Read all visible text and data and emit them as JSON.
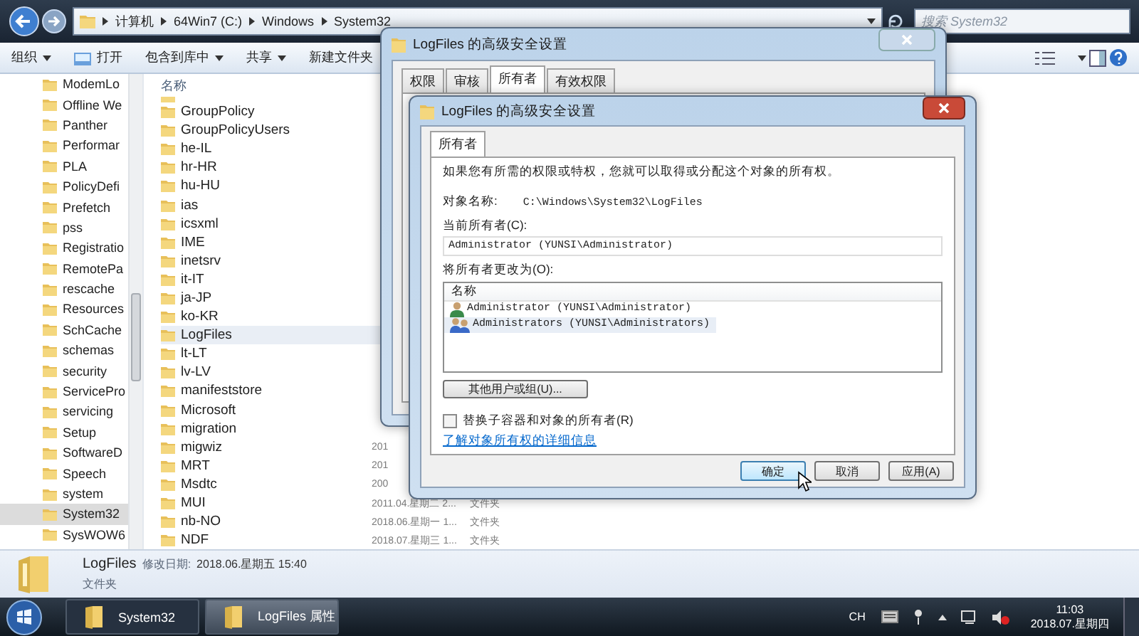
{
  "explorer": {
    "address": [
      "计算机",
      "64Win7 (C:)",
      "Windows",
      "System32"
    ],
    "search": {
      "placeholder": "搜索 System32"
    },
    "toolbar": [
      {
        "kind": "plain",
        "label": "组织",
        "dropdown": true
      },
      {
        "kind": "icon",
        "label": "打开",
        "dropdown": false
      },
      {
        "kind": "plain",
        "label": "包含到库中",
        "dropdown": true
      },
      {
        "kind": "plain",
        "label": "共享",
        "dropdown": true
      },
      {
        "kind": "plain",
        "label": "新建文件夹",
        "dropdown": false
      }
    ],
    "nav": [
      {
        "label": "ModemLo",
        "selected": false
      },
      {
        "label": "Offline We",
        "selected": false
      },
      {
        "label": "Panther",
        "selected": false
      },
      {
        "label": "Performar",
        "selected": false
      },
      {
        "label": "PLA",
        "selected": false
      },
      {
        "label": "PolicyDefi",
        "selected": false
      },
      {
        "label": "Prefetch",
        "selected": false
      },
      {
        "label": "pss",
        "selected": false
      },
      {
        "label": "Registratio",
        "selected": false
      },
      {
        "label": "RemotePa",
        "selected": false
      },
      {
        "label": "rescache",
        "selected": false
      },
      {
        "label": "Resources",
        "selected": false
      },
      {
        "label": "SchCache",
        "selected": false
      },
      {
        "label": "schemas",
        "selected": false
      },
      {
        "label": "security",
        "selected": false
      },
      {
        "label": "ServicePro",
        "selected": false
      },
      {
        "label": "servicing",
        "selected": false
      },
      {
        "label": "Setup",
        "selected": false
      },
      {
        "label": "SoftwareD",
        "selected": false
      },
      {
        "label": "Speech",
        "selected": false
      },
      {
        "label": "system",
        "selected": false
      },
      {
        "label": "System32",
        "selected": true
      },
      {
        "label": "SysWOW6",
        "selected": false
      }
    ],
    "files": {
      "column": "名称",
      "rows": [
        {
          "name": "GroupPolicy",
          "selected": false
        },
        {
          "name": "GroupPolicyUsers",
          "selected": false
        },
        {
          "name": "he-IL",
          "selected": false
        },
        {
          "name": "hr-HR",
          "selected": false
        },
        {
          "name": "hu-HU",
          "selected": false
        },
        {
          "name": "ias",
          "selected": false
        },
        {
          "name": "icsxml",
          "selected": false
        },
        {
          "name": "IME",
          "selected": false
        },
        {
          "name": "inetsrv",
          "selected": false
        },
        {
          "name": "it-IT",
          "selected": false
        },
        {
          "name": "ja-JP",
          "selected": false
        },
        {
          "name": "ko-KR",
          "selected": false
        },
        {
          "name": "LogFiles",
          "selected": true
        },
        {
          "name": "lt-LT",
          "selected": false
        },
        {
          "name": "lv-LV",
          "selected": false
        },
        {
          "name": "manifeststore",
          "selected": false
        },
        {
          "name": "Microsoft",
          "selected": false
        },
        {
          "name": "migration",
          "selected": false
        },
        {
          "name": "migwiz",
          "selected": false,
          "date": "201"
        },
        {
          "name": "MRT",
          "selected": false,
          "date": "201"
        },
        {
          "name": "Msdtc",
          "selected": false,
          "date": "200"
        },
        {
          "name": "MUI",
          "selected": false,
          "date": "2011.04.星期二 2...",
          "type": "文件夹"
        },
        {
          "name": "nb-NO",
          "selected": false,
          "date": "2018.06.星期一 1...",
          "type": "文件夹"
        },
        {
          "name": "NDF",
          "selected": false,
          "date": "2018.07.星期三 1...",
          "type": "文件夹"
        }
      ]
    },
    "details": {
      "name": "LogFiles",
      "modified_label": "修改日期:",
      "modified": "2018.06.星期五 15:40",
      "type": "文件夹"
    }
  },
  "back_dialog": {
    "title": "LogFiles 的高级安全设置",
    "tabs": [
      {
        "label": "权限",
        "selected": false
      },
      {
        "label": "审核",
        "selected": false
      },
      {
        "label": "所有者",
        "selected": true
      },
      {
        "label": "有效权限",
        "selected": false
      }
    ]
  },
  "front_dialog": {
    "title": "LogFiles 的高级安全设置",
    "tabs": [
      {
        "label": "所有者",
        "selected": true
      }
    ],
    "intro": "如果您有所需的权限或特权，您就可以取得或分配这个对象的所有权。",
    "object_label": "对象名称:",
    "object_value": "C:\\Windows\\System32\\LogFiles",
    "current_owner_label": "当前所有者(C):",
    "current_owner_value": "Administrator (YUNSI\\Administrator)",
    "change_label": "将所有者更改为(O):",
    "list": {
      "column": "名称",
      "rows": [
        {
          "kind": "user",
          "name": "Administrator (YUNSI\\Administrator)",
          "selected": false
        },
        {
          "kind": "group",
          "name": "Administrators (YUNSI\\Administrators)",
          "selected": true
        }
      ]
    },
    "other_button": "其他用户或组(U)...",
    "replace_checkbox": {
      "label": "替换子容器和对象的所有者(R)",
      "checked": false
    },
    "link": "了解对象所有权的详细信息",
    "buttons": [
      {
        "label": "确定",
        "default": true
      },
      {
        "label": "取消",
        "default": false
      },
      {
        "label": "应用(A)",
        "default": false
      }
    ]
  },
  "taskbar": {
    "buttons": [
      {
        "label": "System32",
        "selected": false
      },
      {
        "label": "LogFiles 属性",
        "selected": true
      }
    ],
    "lang": "CH",
    "time": "11:03",
    "date": "2018.07.星期四"
  }
}
